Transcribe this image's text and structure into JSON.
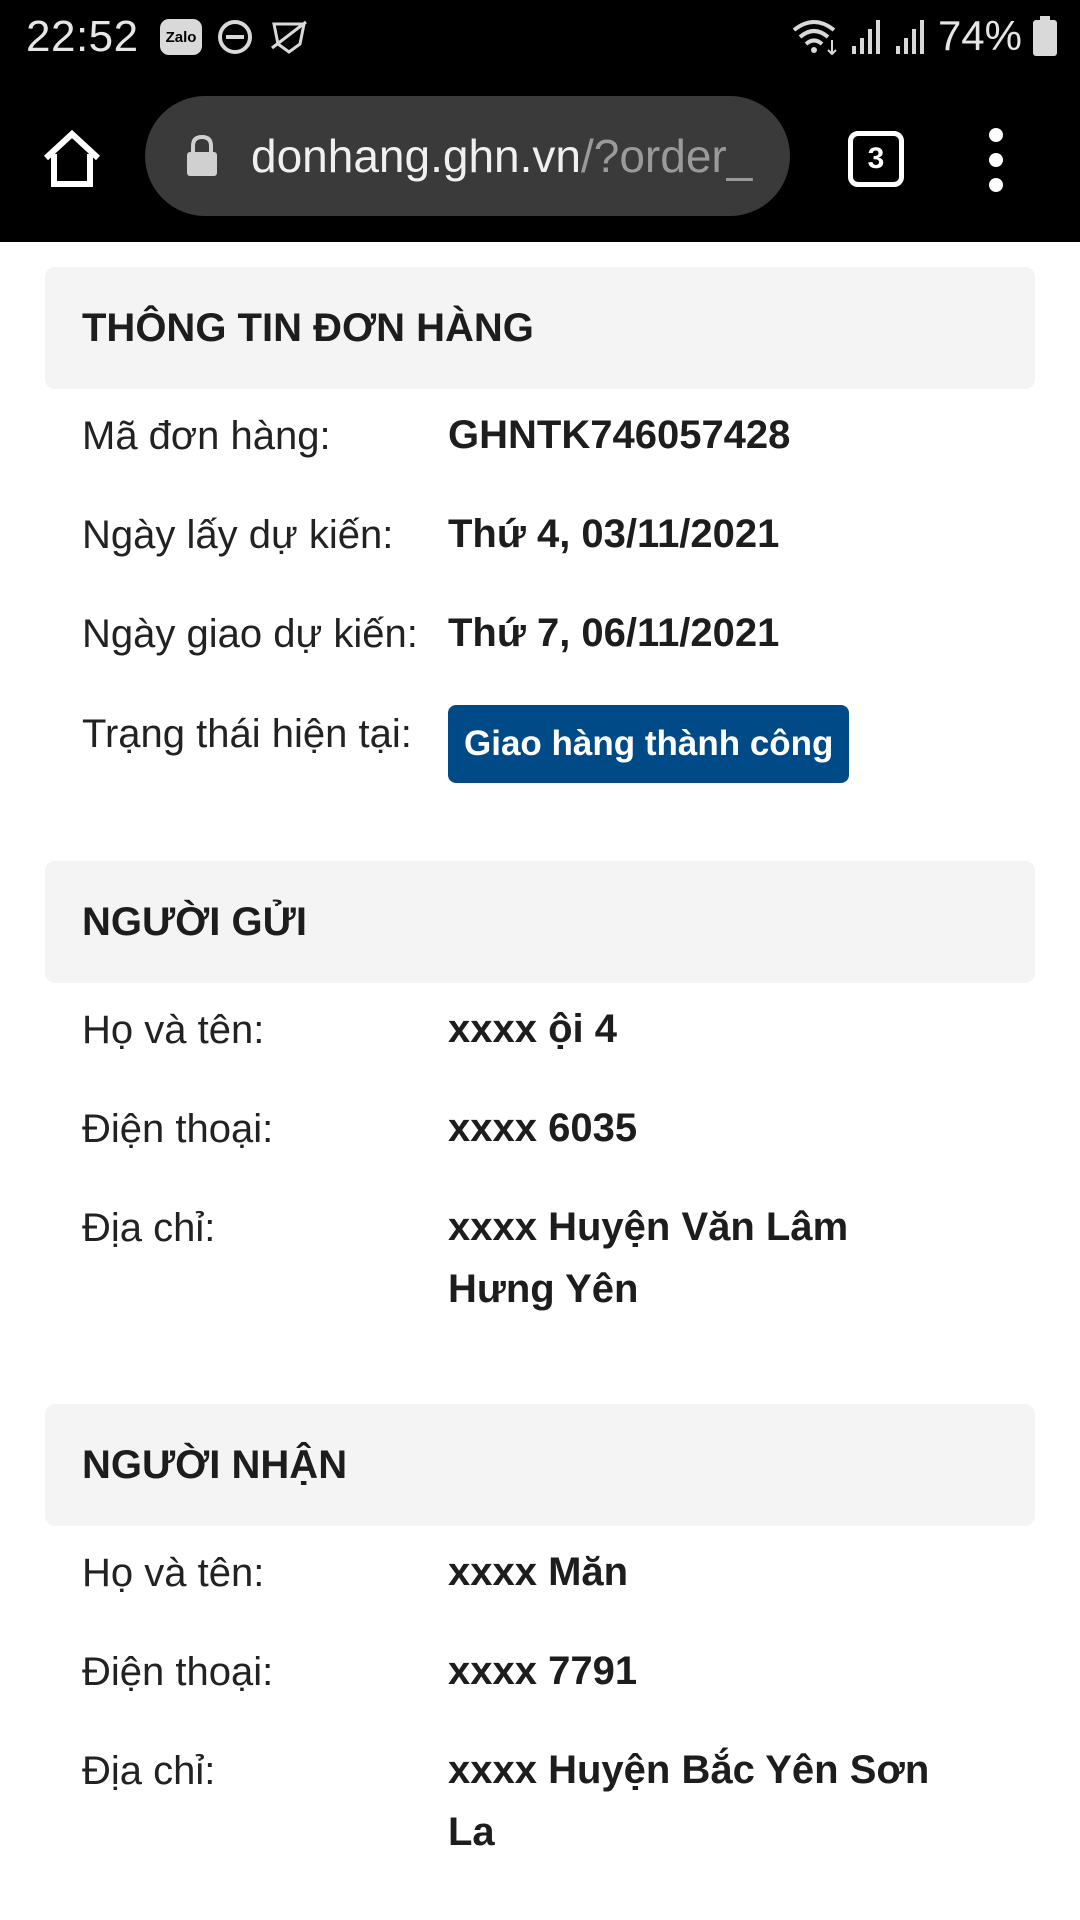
{
  "status_bar": {
    "time": "22:52",
    "notification_icons": [
      "zalo-icon",
      "dnd-icon",
      "shield-icon"
    ],
    "zalo_label": "Zalo",
    "battery": "74%"
  },
  "browser": {
    "url_domain": "donhang.ghn.vn",
    "url_path": "/?order_",
    "tab_count": "3"
  },
  "order_info": {
    "title": "THÔNG TIN ĐƠN HÀNG",
    "rows": [
      {
        "label": "Mã đơn hàng:",
        "value": "GHNTK746057428"
      },
      {
        "label": "Ngày lấy dự kiến:",
        "value": "Thứ 4, 03/11/2021"
      },
      {
        "label": "Ngày giao dự kiến:",
        "value": "Thứ 7, 06/11/2021"
      }
    ],
    "status_label": "Trạng thái hiện tại:",
    "status_value": "Giao hàng thành công",
    "status_color": "#004a87"
  },
  "sender": {
    "title": "NGƯỜI GỬI",
    "name_label": "Họ và tên:",
    "name_value": "xxxx ội 4",
    "phone_label": "Điện thoại:",
    "phone_value": "xxxx 6035",
    "address_label": "Địa chỉ:",
    "address_line1": "xxxx Huyện Văn Lâm",
    "address_line2": "Hưng Yên"
  },
  "receiver": {
    "title": "NGƯỜI NHẬN",
    "name_label": "Họ và tên:",
    "name_value": "xxxx Măn",
    "phone_label": "Điện thoại:",
    "phone_value": "xxxx 7791",
    "address_label": "Địa chỉ:",
    "address_line1": "xxxx Huyện Bắc Yên Sơn",
    "address_line2": "La"
  }
}
